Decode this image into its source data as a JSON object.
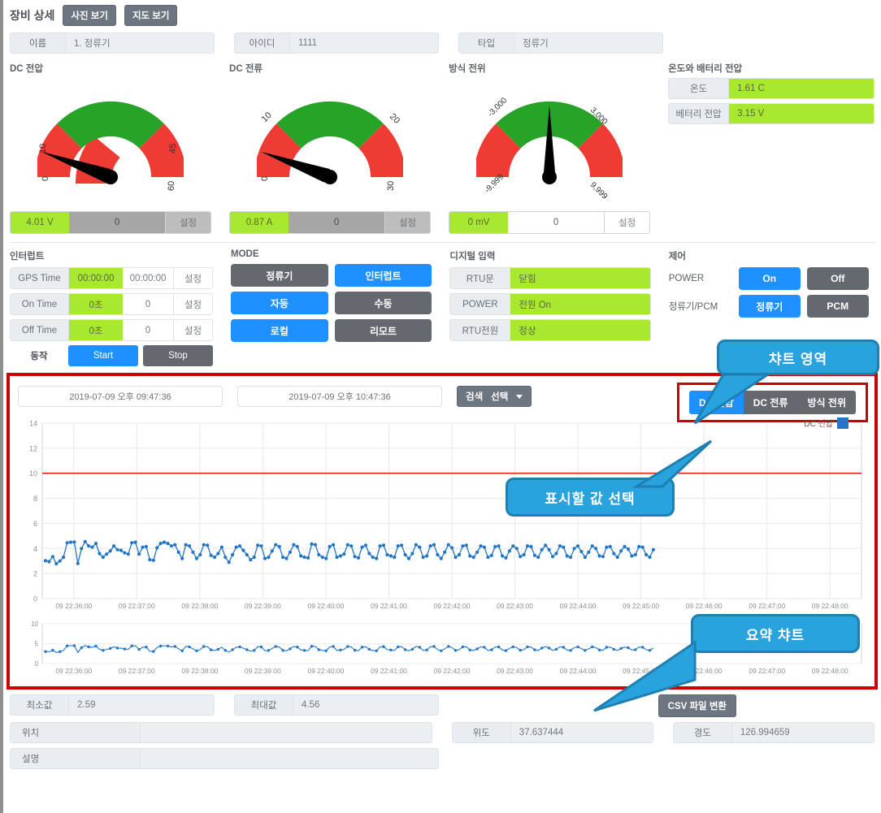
{
  "header": {
    "title": "장비 상세",
    "photo_button": "사진 보기",
    "map_button": "지도 보기"
  },
  "top_fields": [
    {
      "label": "이름",
      "value": "1. 정류기"
    },
    {
      "label": "아이디",
      "value": "1111"
    },
    {
      "label": "타입",
      "value": "정류기"
    }
  ],
  "gauges": [
    {
      "title": "DC 전압",
      "ticks": [
        "0",
        "10",
        "45",
        "60"
      ],
      "value": 4.01,
      "value_text": "4.01 V",
      "setpoint": "0",
      "set_button": "설정",
      "min": 0,
      "max": 60,
      "green_from": 10,
      "green_to": 45,
      "needle_value": 4.01
    },
    {
      "title": "DC 전류",
      "ticks": [
        "0",
        "10",
        "20",
        "30"
      ],
      "value": 0.87,
      "value_text": "0.87 A",
      "setpoint": "0",
      "set_button": "설정",
      "min": 0,
      "max": 30,
      "green_from": 10,
      "green_to": 20,
      "needle_value": 0.87
    },
    {
      "title": "방식 전위",
      "ticks": [
        "-9,999",
        "-3,000",
        "3,000",
        "9,999"
      ],
      "value": 0,
      "value_text": "0 mV",
      "setpoint": "0",
      "set_button": "설정",
      "min": -9999,
      "max": 9999,
      "green_from": -3000,
      "green_to": 3000,
      "needle_value": 0
    }
  ],
  "temperature_panel": {
    "title": "온도와 배터리 전압",
    "rows": [
      {
        "label": "온도",
        "value": "1.61 C"
      },
      {
        "label": "베터리 전압",
        "value": "3.15 V"
      }
    ]
  },
  "interrupt": {
    "title": "인터럽트",
    "rows": [
      {
        "label": "GPS Time",
        "green": "00:00:00",
        "white": "00:00:00",
        "button": "설정"
      },
      {
        "label": "On Time",
        "green": "0초",
        "white": "0",
        "button": "설정"
      },
      {
        "label": "Off Time",
        "green": "0초",
        "white": "0",
        "button": "설정"
      }
    ],
    "action_label": "동작",
    "start_button": "Start",
    "stop_button": "Stop"
  },
  "mode": {
    "title": "MODE",
    "buttons": [
      {
        "label": "정류기",
        "active": false
      },
      {
        "label": "인터럽트",
        "active": true
      },
      {
        "label": "자동",
        "active": true
      },
      {
        "label": "수동",
        "active": false
      },
      {
        "label": "로컬",
        "active": true
      },
      {
        "label": "리모트",
        "active": false
      }
    ]
  },
  "digital_input": {
    "title": "디지털 입력",
    "rows": [
      {
        "label": "RTU문",
        "value": "닫힘"
      },
      {
        "label": "POWER",
        "value": "전원 On"
      },
      {
        "label": "RTU전원",
        "value": "정상"
      }
    ]
  },
  "control": {
    "title": "제어",
    "rows": [
      {
        "label": "POWER",
        "on": "On",
        "off": "Off",
        "on_active": true
      },
      {
        "label": "정류기/PCM",
        "on": "정류기",
        "off": "PCM",
        "on_active": true
      }
    ]
  },
  "chart_toolbar": {
    "start_date": "2019-07-09 오후 09:47:36",
    "end_date": "2019-07-09 오후 10:47:36",
    "search_label": "검색",
    "select_label": "선택"
  },
  "series_selector": {
    "options": [
      {
        "label": "DC 전압",
        "active": true
      },
      {
        "label": "DC 전류",
        "active": false
      },
      {
        "label": "방식 전위",
        "active": false
      }
    ]
  },
  "callouts": [
    {
      "text": "챠트 영역"
    },
    {
      "text": "표시할 값 선택"
    },
    {
      "text": "요약 챠트"
    }
  ],
  "summary_fields": [
    {
      "label": "최소값",
      "value": "2.59"
    },
    {
      "label": "최대값",
      "value": "4.56"
    },
    {
      "label": "위치",
      "value": ""
    },
    {
      "label": "위도",
      "value": "37.637444"
    },
    {
      "label": "경도",
      "value": "126.994659"
    },
    {
      "label": "설명",
      "value": ""
    }
  ],
  "csv_button": "CSV 파일 변환",
  "colors": {
    "accent_blue": "#1e90ff",
    "gray_button": "#63696f",
    "green_value": "#a8e830",
    "gauge_green": "#27a327",
    "gauge_red": "#ee3b33",
    "series_blue": "#2176c7",
    "threshold_red": "#e2231a",
    "callout_blue": "#29a3dd",
    "region_border": "#cc0000"
  },
  "chart_data": {
    "type": "line",
    "title": "",
    "xlabel": "",
    "ylabel": "",
    "ylim": [
      0,
      14
    ],
    "yticks": [
      0,
      2,
      4,
      6,
      8,
      10,
      12,
      14
    ],
    "grid": true,
    "legend_position": "top-right",
    "threshold_line": 10,
    "xticks": [
      "09 22:36:00",
      "09 22:37:00",
      "09 22:38:00",
      "09 22:39:00",
      "09 22:40:00",
      "09 22:41:00",
      "09 22:42:00",
      "09 22:43:00",
      "09 22:44:00",
      "09 22:45:00",
      "09 22:46:00",
      "09 22:47:00",
      "09 22:48:00"
    ],
    "x_range": [
      "09 22:35:40",
      "09 22:48:20"
    ],
    "series": [
      {
        "name": "DC 전압",
        "color": "#2176c7",
        "values": [
          3.02,
          2.95,
          3.35,
          2.78,
          3.0,
          3.3,
          4.45,
          4.5,
          4.52,
          2.8,
          4.0,
          4.55,
          4.2,
          4.1,
          4.4,
          3.6,
          3.3,
          3.55,
          3.8,
          4.2,
          3.9,
          3.85,
          3.65,
          3.55,
          4.45,
          4.5,
          3.55,
          4.1,
          4.15,
          3.1,
          3.05,
          4.05,
          4.4,
          4.5,
          4.4,
          4.2,
          4.3,
          3.7,
          3.2,
          4.3,
          4.2,
          3.7,
          3.2,
          3.5,
          4.3,
          4.25,
          3.45,
          3.3,
          3.6,
          4.1,
          3.3,
          2.9,
          3.5,
          4.1,
          4.2,
          3.85,
          3.5,
          3.1,
          3.3,
          4.25,
          4.2,
          3.2,
          3.3,
          3.8,
          4.3,
          4.15,
          3.3,
          3.2,
          3.7,
          4.3,
          4.15,
          3.4,
          3.3,
          3.25,
          4.35,
          4.3,
          3.5,
          3.3,
          3.2,
          4.15,
          4.3,
          3.3,
          3.4,
          3.55,
          4.3,
          4.2,
          3.35,
          3.25,
          4.1,
          4.25,
          3.6,
          3.3,
          3.2,
          4.2,
          4.25,
          3.5,
          3.4,
          3.3,
          4.2,
          4.25,
          3.5,
          3.2,
          3.6,
          4.3,
          4.1,
          3.3,
          3.4,
          4.2,
          4.3,
          3.5,
          3.2,
          3.7,
          4.3,
          4.05,
          3.3,
          3.5,
          4.2,
          4.25,
          3.4,
          3.3,
          3.7,
          4.2,
          4.1,
          3.3,
          3.45,
          4.15,
          4.2,
          3.4,
          3.25,
          3.8,
          4.2,
          4.0,
          3.35,
          3.5,
          4.2,
          4.15,
          3.45,
          3.3,
          3.9,
          4.25,
          3.9,
          3.35,
          3.6,
          4.2,
          4.1,
          3.4,
          3.3,
          4.0,
          4.2,
          3.75,
          3.3,
          3.7,
          4.2,
          4.0,
          3.4,
          3.35,
          4.1,
          4.15,
          3.6,
          3.3,
          3.8,
          4.15,
          3.95,
          3.4,
          3.5,
          4.15,
          4.1,
          3.5,
          3.3,
          3.9
        ]
      }
    ],
    "summary_chart": {
      "ylim": [
        0,
        10
      ],
      "yticks": [
        0,
        5,
        10
      ],
      "xticks": [
        "09 22:36:00",
        "09 22:37:00",
        "09 22:38:00",
        "09 22:39:00",
        "09 22:40:00",
        "09 22:41:00",
        "09 22:42:00",
        "09 22:43:00",
        "09 22:44:00",
        "09 22:45:00",
        "09 22:46:00",
        "09 22:47:00",
        "09 22:48:00"
      ]
    },
    "min": 2.59,
    "max": 4.56
  }
}
